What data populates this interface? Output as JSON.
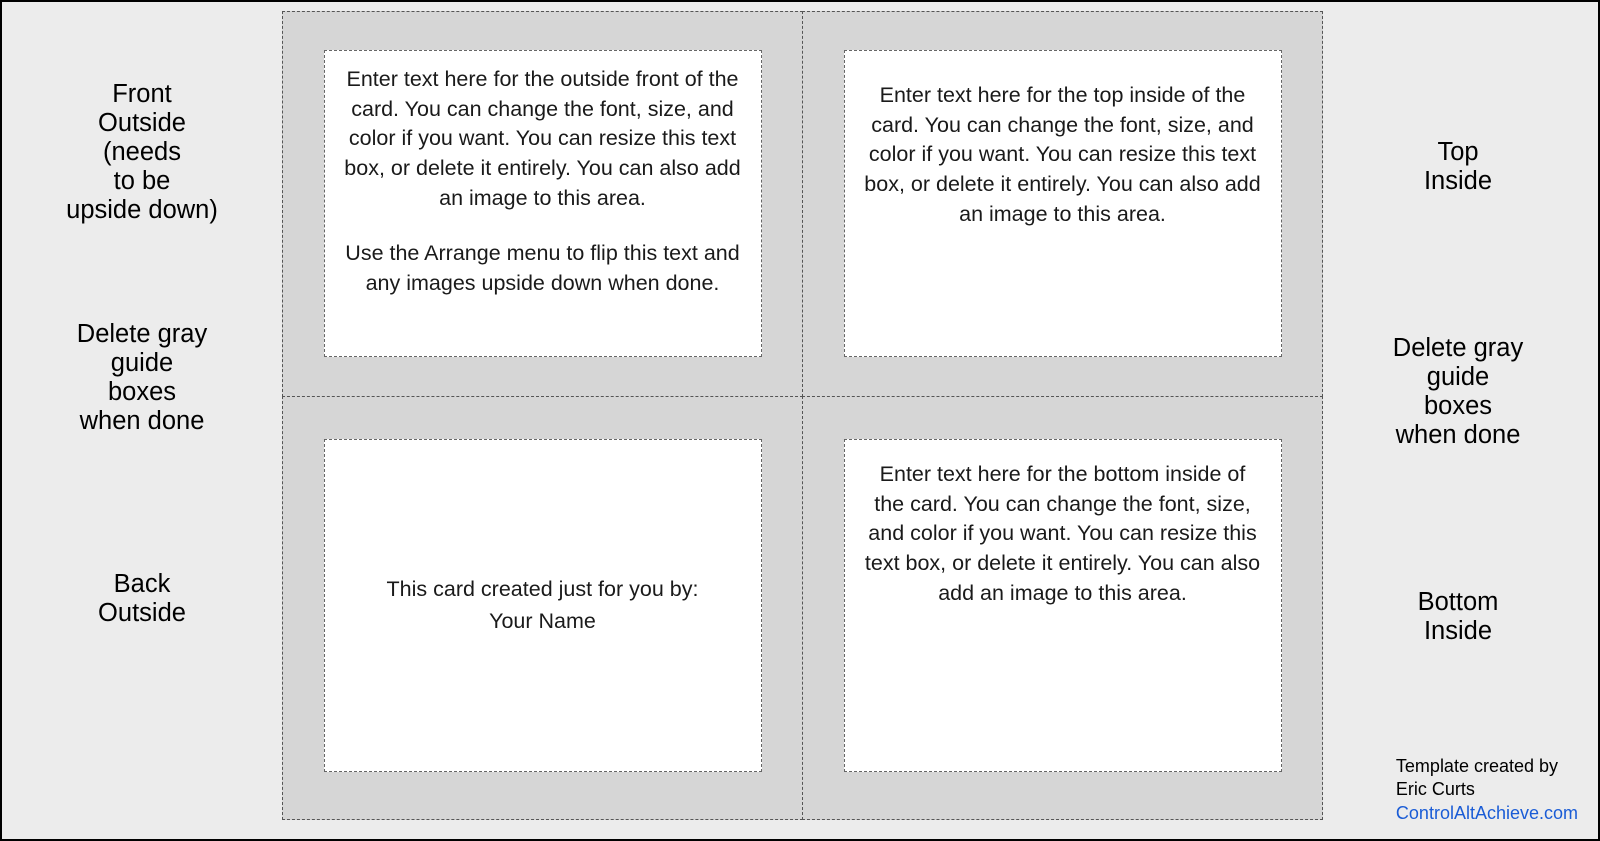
{
  "left": {
    "header_l1": "Front",
    "header_l2": "Outside",
    "header_l3": "(needs",
    "header_l4": "to be",
    "header_l5": "upside down)",
    "mid_l1": "Delete gray",
    "mid_l2": "guide",
    "mid_l3": "boxes",
    "mid_l4": "when done",
    "bot_l1": "Back",
    "bot_l2": "Outside"
  },
  "right": {
    "top_l1": "Top",
    "top_l2": "Inside",
    "mid_l1": "Delete gray",
    "mid_l2": "guide",
    "mid_l3": "boxes",
    "mid_l4": "when done",
    "bot_l1": "Bottom",
    "bot_l2": "Inside",
    "credit_l1": "Template created by",
    "credit_l2": "Eric Curts",
    "credit_link": "ControlAltAchieve.com"
  },
  "quads": {
    "tl": {
      "p1": "Enter text here for the outside front of the card. You can change the font, size, and color if you want. You can resize this text box, or delete it entirely. You can also add an image to this area.",
      "p2": "Use the Arrange menu to flip this text and any images upside down when done."
    },
    "tr": {
      "p1": "Enter text here for the top inside of the card. You can change the font, size, and color if you want. You can resize this text box, or delete it entirely. You can also add an image to this area."
    },
    "bl": {
      "l1": "This card created just for you by:",
      "l2": "Your Name"
    },
    "br": {
      "p1": "Enter text here for the bottom inside of the card. You can change the font, size, and color if you want. You can resize this text box, or delete it entirely. You can also add an image to this area."
    }
  }
}
